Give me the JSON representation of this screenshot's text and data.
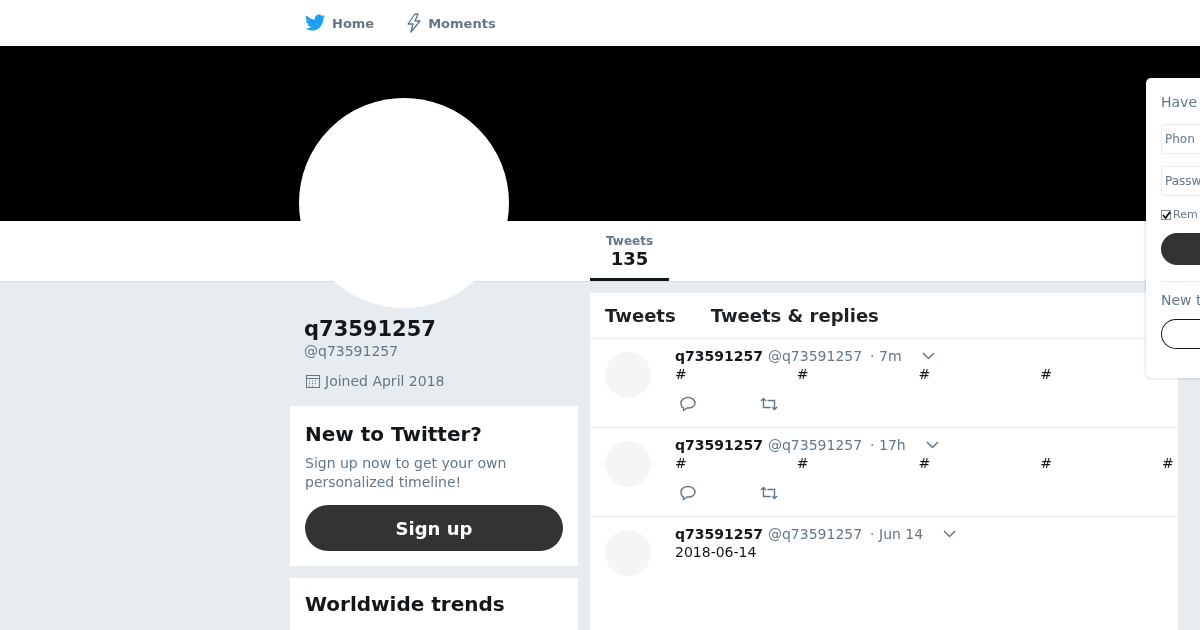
{
  "nav": {
    "items": [
      {
        "label": "Home",
        "kind": "home"
      },
      {
        "label": "Moments",
        "kind": "moments"
      }
    ]
  },
  "profile_nav": {
    "stats": [
      {
        "label": "Tweets",
        "value": "135",
        "selected": true
      }
    ]
  },
  "profile": {
    "name": "q73591257",
    "handle": "@q73591257",
    "joined": "Joined April 2018"
  },
  "signup_card": {
    "title": "New to Twitter?",
    "text": "Sign up now to get your own personalized timeline!",
    "button": "Sign up"
  },
  "trends_card": {
    "title": "Worldwide trends"
  },
  "timeline": {
    "tabs": [
      {
        "label": "Tweets"
      },
      {
        "label": "Tweets & replies"
      }
    ],
    "tweets": [
      {
        "name": "q73591257",
        "handle": "@q73591257",
        "time": "· 7m",
        "kind": "hashtags",
        "tokens": [
          "#",
          "#",
          "#",
          "#"
        ]
      },
      {
        "name": "q73591257",
        "handle": "@q73591257",
        "time": "· 17h",
        "kind": "hashtags",
        "tokens": [
          "#",
          "#",
          "#",
          "#",
          "#"
        ]
      },
      {
        "name": "q73591257",
        "handle": "@q73591257",
        "time": "· Jun 14",
        "kind": "text",
        "text": "2018-06-14"
      }
    ]
  },
  "login_popup": {
    "title": "Have",
    "phone_placeholder": "Phon",
    "password_placeholder": "Passw",
    "remember": {
      "label": "Rem",
      "checked": true
    },
    "section": "New t"
  }
}
